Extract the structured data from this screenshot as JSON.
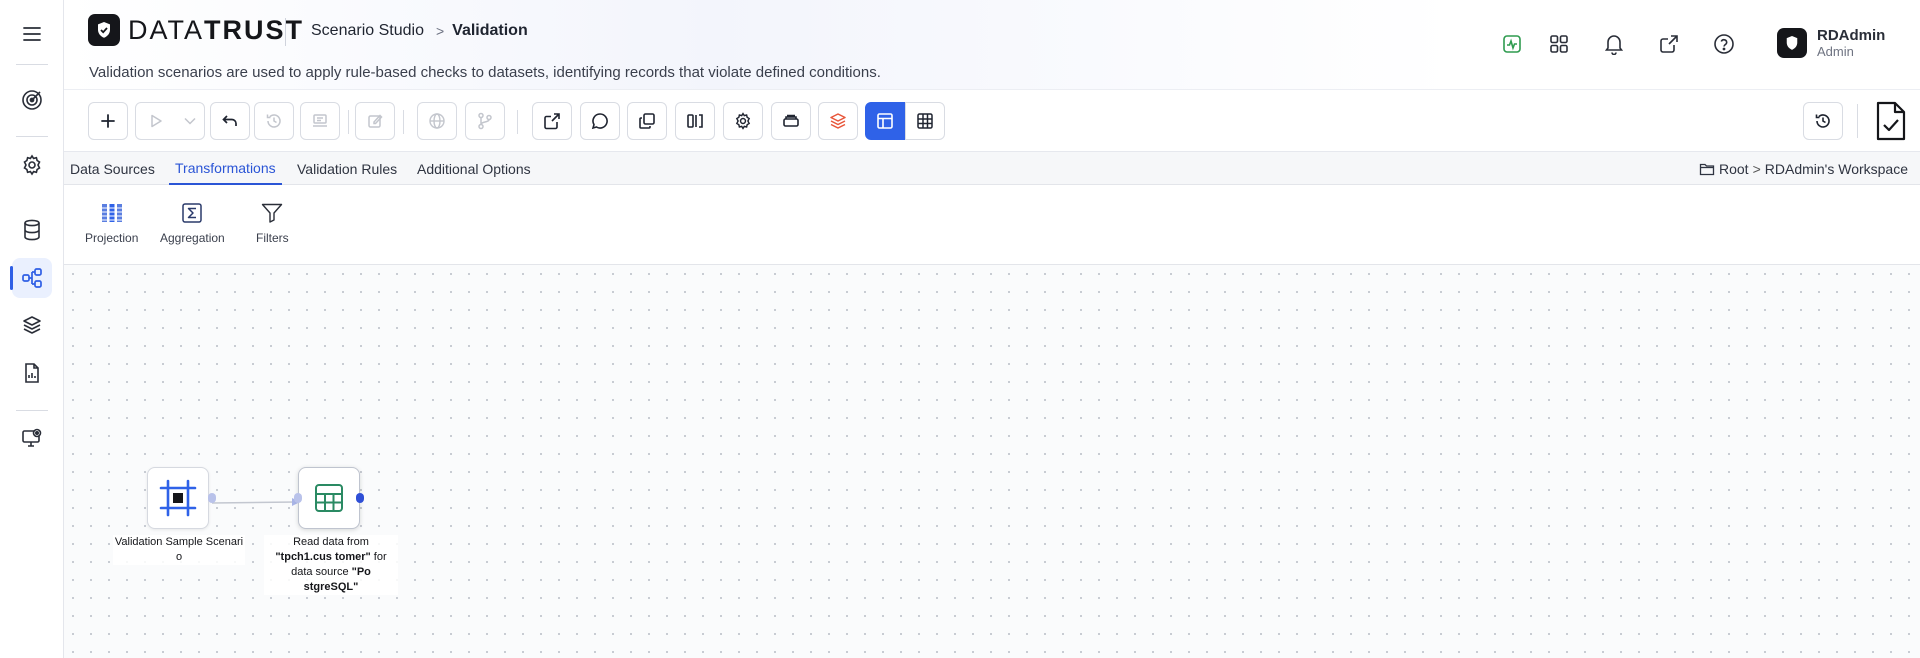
{
  "app": {
    "brand_prefix": "DATA",
    "brand_suffix": "TRUST",
    "breadcrumb": [
      "Scenario Studio",
      "Validation"
    ],
    "breadcrumb_sep": ">",
    "subtitle": "Validation scenarios are used to apply rule-based checks to datasets, identifying records that violate defined conditions."
  },
  "header_icons": [
    "activity-icon",
    "apps-grid-icon",
    "bell-icon",
    "external-link-icon",
    "help-icon"
  ],
  "user": {
    "name": "RDAdmin",
    "role": "Admin"
  },
  "sidebar": {
    "items": [
      {
        "icon": "menu-icon"
      },
      {
        "icon": "target-icon"
      },
      {
        "icon": "gear-icon"
      },
      {
        "icon": "database-icon"
      },
      {
        "icon": "workflow-icon",
        "active": true
      },
      {
        "icon": "layers-icon"
      },
      {
        "icon": "report-icon"
      },
      {
        "icon": "monitor-eye-icon"
      }
    ]
  },
  "tabs": [
    {
      "label": "Data Sources",
      "active": false
    },
    {
      "label": "Transformations",
      "active": true
    },
    {
      "label": "Validation Rules",
      "active": false
    },
    {
      "label": "Additional Options",
      "active": false
    }
  ],
  "workspace_path": {
    "root": "Root",
    "sep": ">",
    "workspace": "RDAdmin's Workspace"
  },
  "transformations": [
    {
      "label": "Projection",
      "icon": "projection-icon"
    },
    {
      "label": "Aggregation",
      "icon": "sigma-icon"
    },
    {
      "label": "Filters",
      "icon": "filter-icon"
    }
  ],
  "nodes": [
    {
      "icon": "scenario-frame-icon",
      "label": "Validation Sample Scenari o"
    },
    {
      "icon": "table-icon",
      "label_prefix": "Read data from ",
      "label_table": "\"tpch1.cus tomer\"",
      "label_mid": " for data source ",
      "label_source": "\"Po stgreSQL\""
    }
  ],
  "colors": {
    "accent": "#2f62e8",
    "active_tab": "#2b55d6",
    "table_icon": "#2a8a63",
    "danger_icon": "#e8563a",
    "status_green": "#2e9b4f"
  }
}
